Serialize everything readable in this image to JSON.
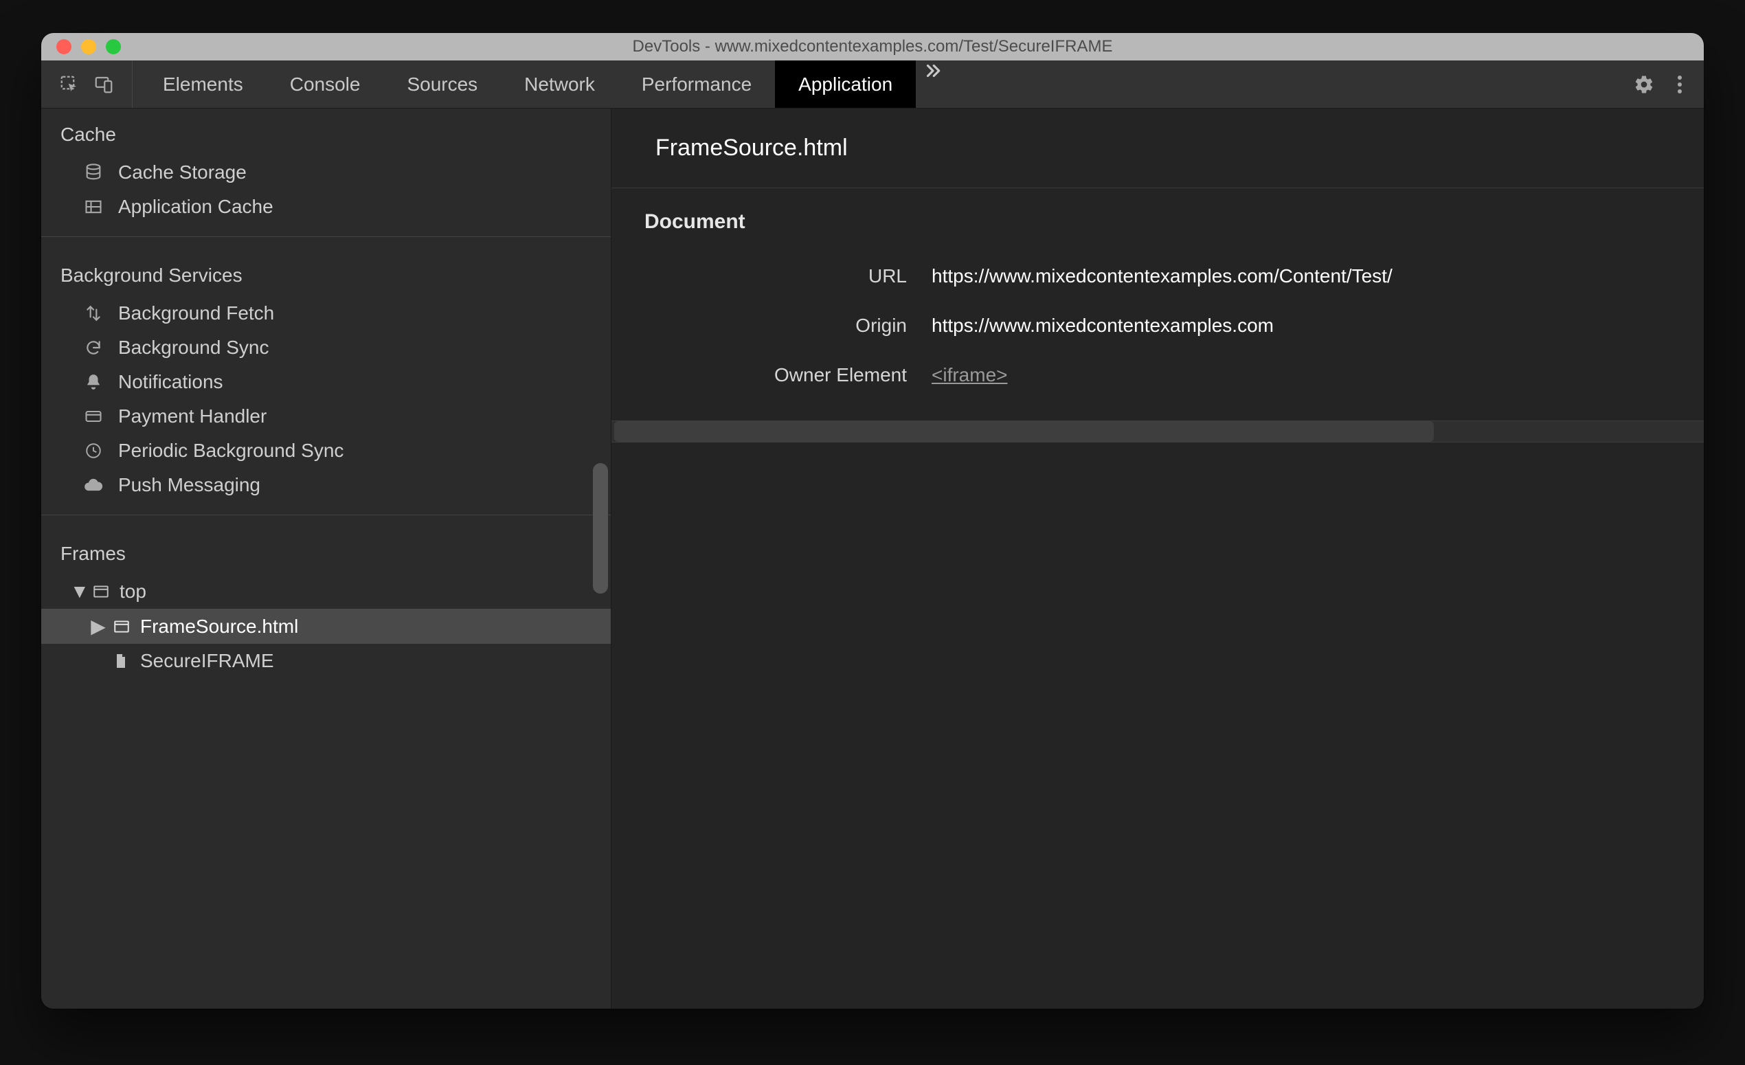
{
  "window": {
    "title": "DevTools - www.mixedcontentexamples.com/Test/SecureIFRAME"
  },
  "toolbar": {
    "tabs": [
      {
        "label": "Elements",
        "active": false
      },
      {
        "label": "Console",
        "active": false
      },
      {
        "label": "Sources",
        "active": false
      },
      {
        "label": "Network",
        "active": false
      },
      {
        "label": "Performance",
        "active": false
      },
      {
        "label": "Application",
        "active": true
      }
    ]
  },
  "sidebar": {
    "groups": [
      {
        "title": "Cache",
        "items": [
          {
            "label": "Cache Storage",
            "icon": "database"
          },
          {
            "label": "Application Cache",
            "icon": "grid"
          }
        ]
      },
      {
        "title": "Background Services",
        "items": [
          {
            "label": "Background Fetch",
            "icon": "transfer"
          },
          {
            "label": "Background Sync",
            "icon": "sync"
          },
          {
            "label": "Notifications",
            "icon": "bell"
          },
          {
            "label": "Payment Handler",
            "icon": "card"
          },
          {
            "label": "Periodic Background Sync",
            "icon": "clock"
          },
          {
            "label": "Push Messaging",
            "icon": "cloud"
          }
        ]
      }
    ],
    "frames": {
      "title": "Frames",
      "tree": {
        "label": "top",
        "children": [
          {
            "label": "FrameSource.html",
            "selected": true,
            "expandable": true,
            "icon": "window"
          },
          {
            "label": "SecureIFRAME",
            "selected": false,
            "icon": "file"
          }
        ]
      }
    }
  },
  "main": {
    "title": "FrameSource.html",
    "section": "Document",
    "fields": [
      {
        "label": "URL",
        "value": "https://www.mixedcontentexamples.com/Content/Test/",
        "link": false
      },
      {
        "label": "Origin",
        "value": "https://www.mixedcontentexamples.com",
        "link": false
      },
      {
        "label": "Owner Element",
        "value": "<iframe>",
        "link": true
      }
    ]
  }
}
